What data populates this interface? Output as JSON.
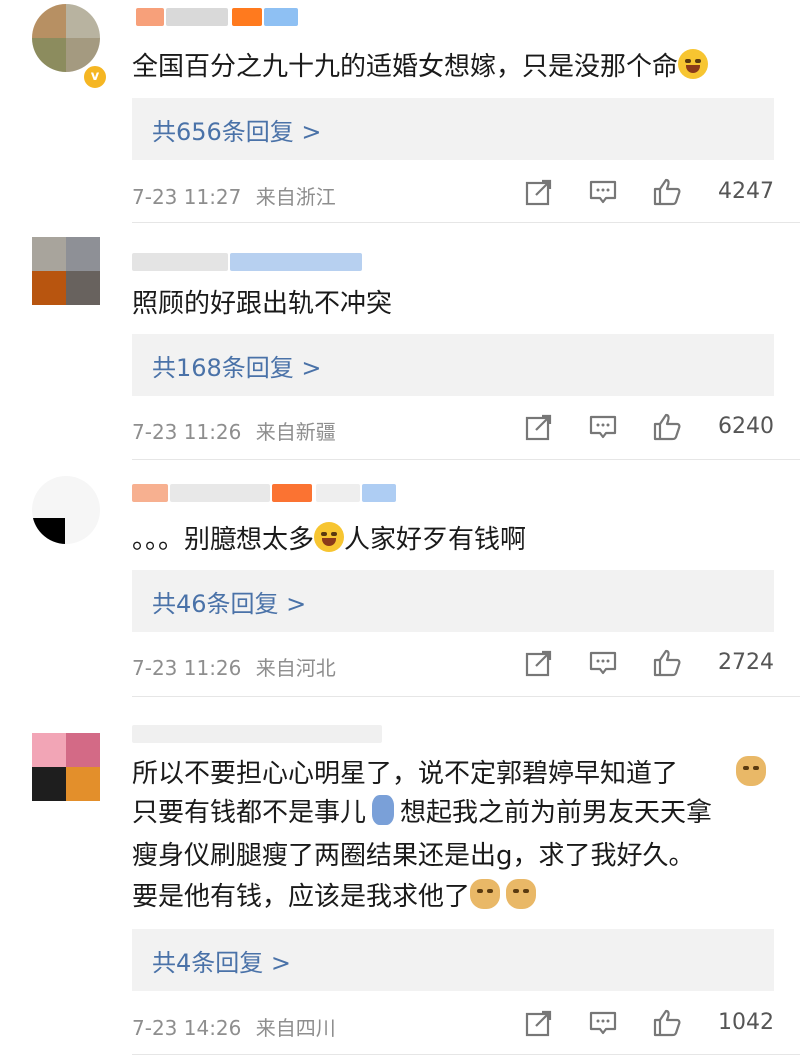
{
  "comments": [
    {
      "text_lines": [
        "全国百分之九十九的适婚女想嫁，只是没那个命"
      ],
      "emoji_after": [
        "laugh-cry-emoji"
      ],
      "replies_label": "共656条回复 >",
      "time": "7-23 11:27",
      "location": "来自浙江",
      "likes": "4247"
    },
    {
      "text_lines": [
        "照顾的好跟出轨不冲突"
      ],
      "replies_label": "共168条回复 >",
      "time": "7-23 11:26",
      "location": "来自新疆",
      "likes": "6240"
    },
    {
      "text_before": "。。。别臆想太多",
      "text_after": "人家好歹有钱啊",
      "replies_label": "共46条回复 >",
      "time": "7-23 11:26",
      "location": "来自河北",
      "likes": "2724"
    },
    {
      "line1": "所以不要担心心明星了，说不定郭碧婷早知道了",
      "line2a": "只要有钱都不是事儿",
      "line2b": "想起我之前为前男友天天拿",
      "line3": "瘦身仪刷腿瘦了两圈结果还是出g，求了我好久。",
      "line4": "要是他有钱，应该是我求他了",
      "replies_label": "共4条回复 >",
      "time": "7-23 14:26",
      "location": "来自四川",
      "likes": "1042"
    }
  ],
  "colors": {
    "reply_link": "#4a72a8",
    "meta_gray": "#8e8e8e",
    "reply_bg": "#f2f2f2",
    "verified_badge": "#f5b623"
  }
}
